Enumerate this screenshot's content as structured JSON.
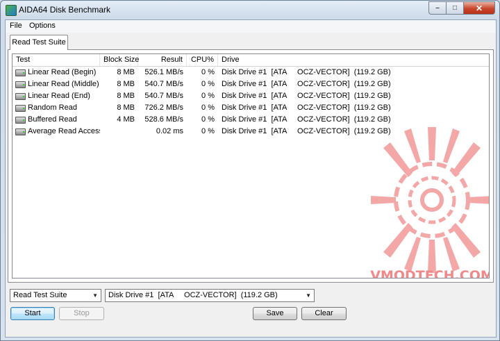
{
  "window": {
    "title": "AIDA64 Disk Benchmark",
    "caption_buttons": {
      "minimize": "–",
      "maximize": "□",
      "close": "✕"
    }
  },
  "menu": {
    "items": [
      "File",
      "Options"
    ]
  },
  "tab": {
    "label": "Read Test Suite"
  },
  "table": {
    "columns": [
      "Test",
      "Block Size",
      "Result",
      "CPU%",
      "Drive"
    ],
    "rows": [
      {
        "test": "Linear Read (Begin)",
        "block": "8 MB",
        "result": "526.1 MB/s",
        "cpu": "0 %",
        "drive": "Disk Drive #1  [ATA     OCZ-VECTOR]  (119.2 GB)"
      },
      {
        "test": "Linear Read (Middle)",
        "block": "8 MB",
        "result": "540.7 MB/s",
        "cpu": "0 %",
        "drive": "Disk Drive #1  [ATA     OCZ-VECTOR]  (119.2 GB)"
      },
      {
        "test": "Linear Read (End)",
        "block": "8 MB",
        "result": "540.7 MB/s",
        "cpu": "0 %",
        "drive": "Disk Drive #1  [ATA     OCZ-VECTOR]  (119.2 GB)"
      },
      {
        "test": "Random Read",
        "block": "8 MB",
        "result": "726.2 MB/s",
        "cpu": "0 %",
        "drive": "Disk Drive #1  [ATA     OCZ-VECTOR]  (119.2 GB)"
      },
      {
        "test": "Buffered Read",
        "block": "4 MB",
        "result": "528.6 MB/s",
        "cpu": "0 %",
        "drive": "Disk Drive #1  [ATA     OCZ-VECTOR]  (119.2 GB)"
      },
      {
        "test": "Average Read Access",
        "block": "",
        "result": "0.02 ms",
        "cpu": "0 %",
        "drive": "Disk Drive #1  [ATA     OCZ-VECTOR]  (119.2 GB)"
      }
    ]
  },
  "watermark": {
    "text": "VMODTECH.COM",
    "color": "#f08a8a"
  },
  "controls": {
    "suite_select": "Read Test Suite",
    "drive_select": "Disk Drive #1  [ATA     OCZ-VECTOR]  (119.2 GB)",
    "start": "Start",
    "stop": "Stop",
    "save": "Save",
    "clear": "Clear"
  },
  "colors": {
    "titlebar": "#dbe6f3",
    "close_button": "#c9452c",
    "default_button_border": "#3c7fb1"
  },
  "icons": {
    "app": "aida64-icon",
    "row": "hard-disk-icon"
  }
}
